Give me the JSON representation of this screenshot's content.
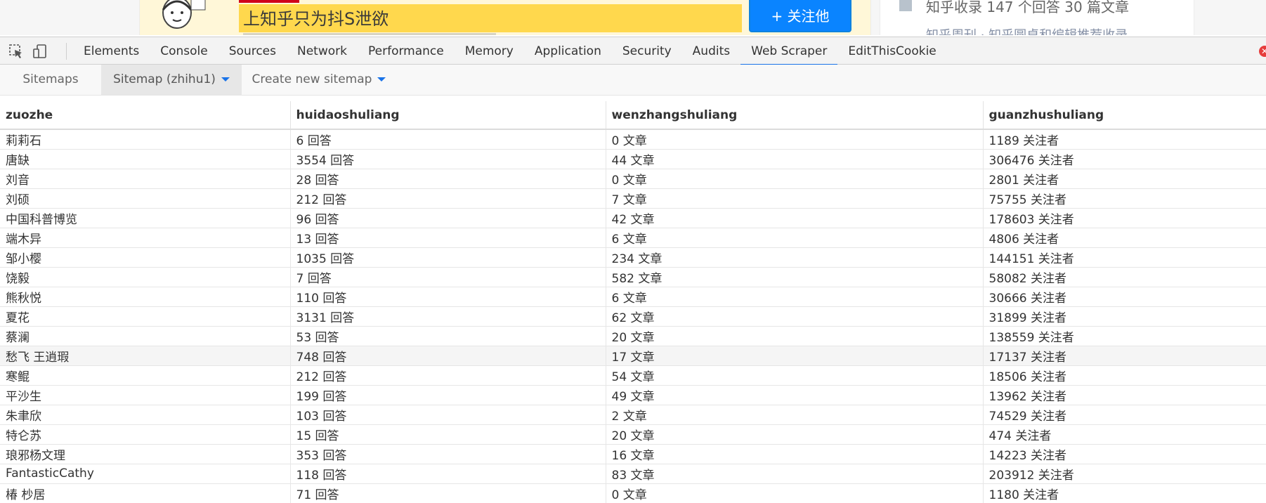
{
  "page": {
    "promo_text": "上知乎只为抖S泄欲",
    "follow_button": "+ 关注他",
    "right_text": "知乎收录 147 个回答 30 篇文章",
    "right_sub": "知乎周刊 · 知乎圆桌和编辑推荐收录"
  },
  "devtools": {
    "tabs": [
      "Elements",
      "Console",
      "Sources",
      "Network",
      "Performance",
      "Memory",
      "Application",
      "Security",
      "Audits",
      "Web Scraper",
      "EditThisCookie"
    ],
    "active_tab": "Web Scraper"
  },
  "web_scraper_nav": {
    "sitemaps": "Sitemaps",
    "current_sitemap": "Sitemap (zhihu1)",
    "create_new": "Create new sitemap"
  },
  "table": {
    "headers": [
      "zuozhe",
      "huidaoshuliang",
      "wenzhangshuliang",
      "guanzhushuliang"
    ],
    "rows": [
      [
        "莉莉石",
        "6 回答",
        "0 文章",
        "1189 关注者"
      ],
      [
        "唐缺",
        "3554 回答",
        "44 文章",
        "306476 关注者"
      ],
      [
        "刘音",
        "28 回答",
        "0 文章",
        "2801 关注者"
      ],
      [
        "刘硕",
        "212 回答",
        "7 文章",
        "75755 关注者"
      ],
      [
        "中国科普博览",
        "96 回答",
        "42 文章",
        "178603 关注者"
      ],
      [
        "端木异",
        "13 回答",
        "6 文章",
        "4806 关注者"
      ],
      [
        "邹小樱",
        "1035 回答",
        "234 文章",
        "144151 关注者"
      ],
      [
        "饶毅",
        "7 回答",
        "582 文章",
        "58082 关注者"
      ],
      [
        "熊秋悦",
        "110 回答",
        "6 文章",
        "30666 关注者"
      ],
      [
        "夏花",
        "3131 回答",
        "62 文章",
        "31899 关注者"
      ],
      [
        "蔡澜",
        "53 回答",
        "20 文章",
        "138559 关注者"
      ],
      [
        "愁飞 王逍瑕",
        "748 回答",
        "17 文章",
        "17137 关注者"
      ],
      [
        "寒鲲",
        "212 回答",
        "54 文章",
        "18506 关注者"
      ],
      [
        "平沙生",
        "199 回答",
        "49 文章",
        "13962 关注者"
      ],
      [
        "朱聿欣",
        "103 回答",
        "2 文章",
        "74529 关注者"
      ],
      [
        "特仑苏",
        "15 回答",
        "20 文章",
        "474 关注者"
      ],
      [
        "琅邪杨文理",
        "353 回答",
        "16 文章",
        "14223 关注者"
      ],
      [
        "FantasticCathy",
        "118 回答",
        "83 文章",
        "203912 关注者"
      ],
      [
        "椿 杪居",
        "71 回答",
        "0 文章",
        "1180 关注者"
      ]
    ],
    "highlight_row": 11
  },
  "colors": {
    "accent": "#1a73e8",
    "promo_bg": "#ffd84d",
    "follow_btn": "#0a84ff"
  },
  "icons": [
    "inspect-element-icon",
    "device-toggle-icon",
    "close-devtools-icon",
    "caret-down-icon"
  ]
}
